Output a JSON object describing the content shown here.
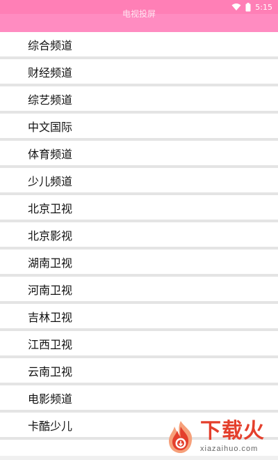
{
  "status_bar": {
    "time": "5:15",
    "icons": [
      "wifi-icon",
      "battery-icon"
    ]
  },
  "app_bar": {
    "title": "电视投屏"
  },
  "colors": {
    "status_bar": "#ff7fb6",
    "app_bar": "#ff8cc1",
    "divider": "#e4e4e4",
    "watermark": "#e43f2c"
  },
  "channels": [
    "综合频道",
    "财经频道",
    "综艺频道",
    "中文国际",
    "体育频道",
    "少儿频道",
    "北京卫视",
    "北京影视",
    "湖南卫视",
    "河南卫视",
    "吉林卫视",
    "江西卫视",
    "云南卫视",
    "电影频道",
    "卡酷少儿"
  ],
  "watermark": {
    "brand": "下载火",
    "domain": "xiazaihuo.com"
  }
}
